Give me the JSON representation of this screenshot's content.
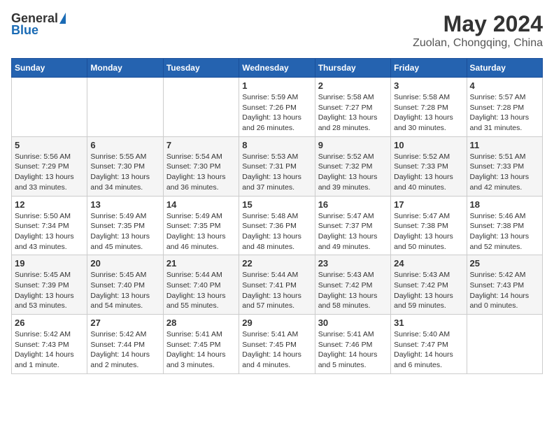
{
  "header": {
    "logo_general": "General",
    "logo_blue": "Blue",
    "month": "May 2024",
    "location": "Zuolan, Chongqing, China"
  },
  "weekdays": [
    "Sunday",
    "Monday",
    "Tuesday",
    "Wednesday",
    "Thursday",
    "Friday",
    "Saturday"
  ],
  "weeks": [
    [
      {
        "day": "",
        "info": ""
      },
      {
        "day": "",
        "info": ""
      },
      {
        "day": "",
        "info": ""
      },
      {
        "day": "1",
        "info": "Sunrise: 5:59 AM\nSunset: 7:26 PM\nDaylight: 13 hours\nand 26 minutes."
      },
      {
        "day": "2",
        "info": "Sunrise: 5:58 AM\nSunset: 7:27 PM\nDaylight: 13 hours\nand 28 minutes."
      },
      {
        "day": "3",
        "info": "Sunrise: 5:58 AM\nSunset: 7:28 PM\nDaylight: 13 hours\nand 30 minutes."
      },
      {
        "day": "4",
        "info": "Sunrise: 5:57 AM\nSunset: 7:28 PM\nDaylight: 13 hours\nand 31 minutes."
      }
    ],
    [
      {
        "day": "5",
        "info": "Sunrise: 5:56 AM\nSunset: 7:29 PM\nDaylight: 13 hours\nand 33 minutes."
      },
      {
        "day": "6",
        "info": "Sunrise: 5:55 AM\nSunset: 7:30 PM\nDaylight: 13 hours\nand 34 minutes."
      },
      {
        "day": "7",
        "info": "Sunrise: 5:54 AM\nSunset: 7:30 PM\nDaylight: 13 hours\nand 36 minutes."
      },
      {
        "day": "8",
        "info": "Sunrise: 5:53 AM\nSunset: 7:31 PM\nDaylight: 13 hours\nand 37 minutes."
      },
      {
        "day": "9",
        "info": "Sunrise: 5:52 AM\nSunset: 7:32 PM\nDaylight: 13 hours\nand 39 minutes."
      },
      {
        "day": "10",
        "info": "Sunrise: 5:52 AM\nSunset: 7:33 PM\nDaylight: 13 hours\nand 40 minutes."
      },
      {
        "day": "11",
        "info": "Sunrise: 5:51 AM\nSunset: 7:33 PM\nDaylight: 13 hours\nand 42 minutes."
      }
    ],
    [
      {
        "day": "12",
        "info": "Sunrise: 5:50 AM\nSunset: 7:34 PM\nDaylight: 13 hours\nand 43 minutes."
      },
      {
        "day": "13",
        "info": "Sunrise: 5:49 AM\nSunset: 7:35 PM\nDaylight: 13 hours\nand 45 minutes."
      },
      {
        "day": "14",
        "info": "Sunrise: 5:49 AM\nSunset: 7:35 PM\nDaylight: 13 hours\nand 46 minutes."
      },
      {
        "day": "15",
        "info": "Sunrise: 5:48 AM\nSunset: 7:36 PM\nDaylight: 13 hours\nand 48 minutes."
      },
      {
        "day": "16",
        "info": "Sunrise: 5:47 AM\nSunset: 7:37 PM\nDaylight: 13 hours\nand 49 minutes."
      },
      {
        "day": "17",
        "info": "Sunrise: 5:47 AM\nSunset: 7:38 PM\nDaylight: 13 hours\nand 50 minutes."
      },
      {
        "day": "18",
        "info": "Sunrise: 5:46 AM\nSunset: 7:38 PM\nDaylight: 13 hours\nand 52 minutes."
      }
    ],
    [
      {
        "day": "19",
        "info": "Sunrise: 5:45 AM\nSunset: 7:39 PM\nDaylight: 13 hours\nand 53 minutes."
      },
      {
        "day": "20",
        "info": "Sunrise: 5:45 AM\nSunset: 7:40 PM\nDaylight: 13 hours\nand 54 minutes."
      },
      {
        "day": "21",
        "info": "Sunrise: 5:44 AM\nSunset: 7:40 PM\nDaylight: 13 hours\nand 55 minutes."
      },
      {
        "day": "22",
        "info": "Sunrise: 5:44 AM\nSunset: 7:41 PM\nDaylight: 13 hours\nand 57 minutes."
      },
      {
        "day": "23",
        "info": "Sunrise: 5:43 AM\nSunset: 7:42 PM\nDaylight: 13 hours\nand 58 minutes."
      },
      {
        "day": "24",
        "info": "Sunrise: 5:43 AM\nSunset: 7:42 PM\nDaylight: 13 hours\nand 59 minutes."
      },
      {
        "day": "25",
        "info": "Sunrise: 5:42 AM\nSunset: 7:43 PM\nDaylight: 14 hours\nand 0 minutes."
      }
    ],
    [
      {
        "day": "26",
        "info": "Sunrise: 5:42 AM\nSunset: 7:43 PM\nDaylight: 14 hours\nand 1 minute."
      },
      {
        "day": "27",
        "info": "Sunrise: 5:42 AM\nSunset: 7:44 PM\nDaylight: 14 hours\nand 2 minutes."
      },
      {
        "day": "28",
        "info": "Sunrise: 5:41 AM\nSunset: 7:45 PM\nDaylight: 14 hours\nand 3 minutes."
      },
      {
        "day": "29",
        "info": "Sunrise: 5:41 AM\nSunset: 7:45 PM\nDaylight: 14 hours\nand 4 minutes."
      },
      {
        "day": "30",
        "info": "Sunrise: 5:41 AM\nSunset: 7:46 PM\nDaylight: 14 hours\nand 5 minutes."
      },
      {
        "day": "31",
        "info": "Sunrise: 5:40 AM\nSunset: 7:47 PM\nDaylight: 14 hours\nand 6 minutes."
      },
      {
        "day": "",
        "info": ""
      }
    ]
  ]
}
